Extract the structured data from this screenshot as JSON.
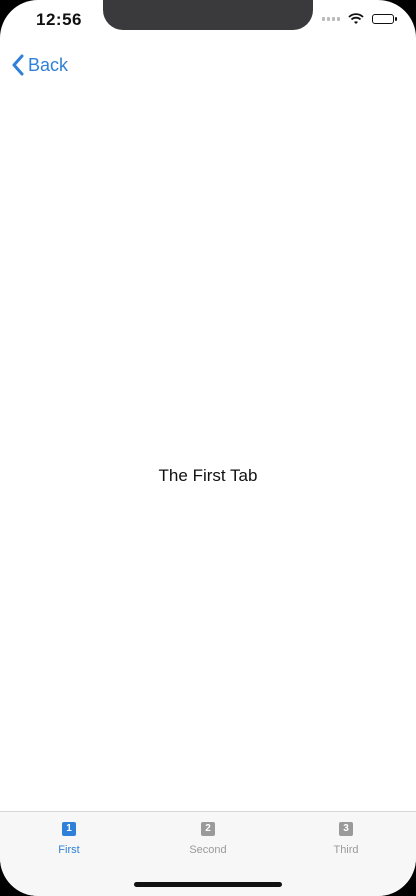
{
  "status_bar": {
    "time": "12:56"
  },
  "nav": {
    "back_label": "Back"
  },
  "main": {
    "label": "The First Tab"
  },
  "tabs": [
    {
      "badge": "1",
      "label": "First"
    },
    {
      "badge": "2",
      "label": "Second"
    },
    {
      "badge": "3",
      "label": "Third"
    }
  ],
  "colors": {
    "accent": "#2f80d8",
    "inactive": "#9a9a9a"
  },
  "icons": [
    "chevron-left-icon",
    "wifi-icon",
    "battery-icon",
    "signal-icon"
  ]
}
